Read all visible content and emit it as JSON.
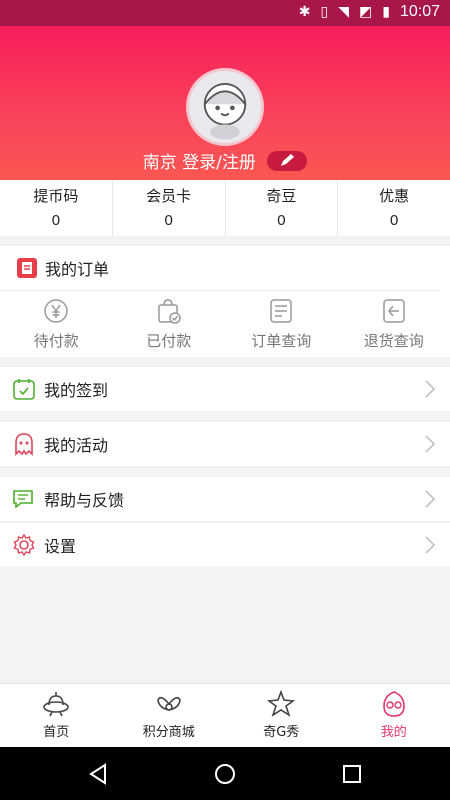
{
  "status_bar": {
    "time": "10:07"
  },
  "profile": {
    "city": "南京",
    "login_label": "登录/注册"
  },
  "stats": [
    {
      "label": "提币码",
      "value": "0"
    },
    {
      "label": "会员卡",
      "value": "0"
    },
    {
      "label": "奇豆",
      "value": "0"
    },
    {
      "label": "优惠",
      "value": "0"
    }
  ],
  "orders": {
    "title": "我的订单",
    "items": [
      {
        "label": "待付款",
        "icon": "yen-circle-icon"
      },
      {
        "label": "已付款",
        "icon": "paid-bag-icon"
      },
      {
        "label": "订单查询",
        "icon": "order-list-icon"
      },
      {
        "label": "退货查询",
        "icon": "return-icon"
      }
    ]
  },
  "menu": {
    "checkin": "我的签到",
    "activity": "我的活动",
    "help": "帮助与反馈",
    "settings": "设置"
  },
  "tabs": [
    {
      "label": "首页",
      "icon": "ufo-icon"
    },
    {
      "label": "积分商城",
      "icon": "wings-icon"
    },
    {
      "label": "奇G秀",
      "icon": "star-figure-icon"
    },
    {
      "label": "我的",
      "icon": "mascot-face-icon"
    }
  ],
  "colors": {
    "accent": "#f71e5c",
    "active_tab": "#e4386d"
  }
}
